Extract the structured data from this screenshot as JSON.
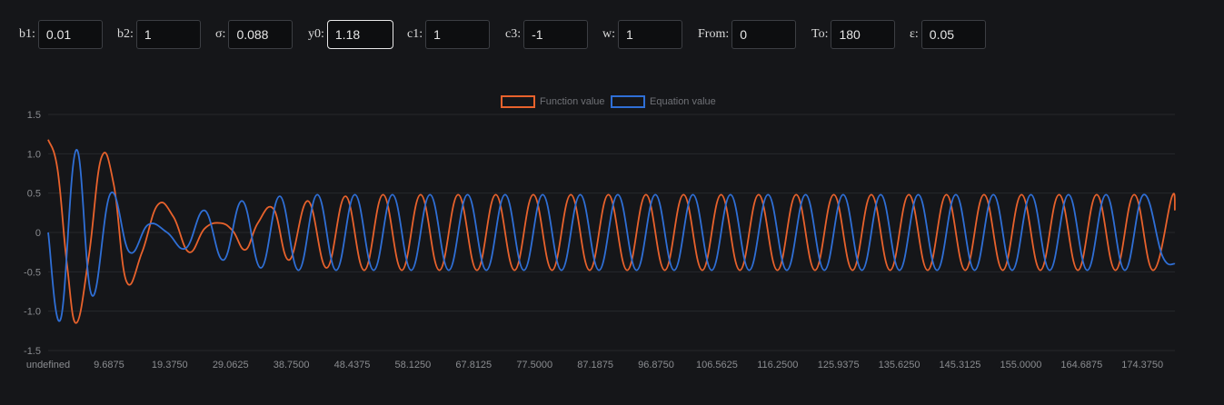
{
  "params": [
    {
      "id": "b1",
      "label": "b1:",
      "value": "0.01"
    },
    {
      "id": "b2",
      "label": "b2:",
      "value": "1"
    },
    {
      "id": "sigma",
      "label": "σ:",
      "value": "0.088"
    },
    {
      "id": "y0",
      "label": "y0:",
      "value": "1.18"
    },
    {
      "id": "c1",
      "label": "c1:",
      "value": "1"
    },
    {
      "id": "c3",
      "label": "c3:",
      "value": "-1"
    },
    {
      "id": "w",
      "label": "w:",
      "value": "1"
    },
    {
      "id": "from",
      "label": "From:",
      "value": "0"
    },
    {
      "id": "to",
      "label": "To:",
      "value": "180"
    },
    {
      "id": "eps",
      "label": "ε:",
      "value": "0.05"
    }
  ],
  "chart_data": {
    "type": "line",
    "title": "",
    "xlabel": "",
    "ylabel": "",
    "legend_position": "top-center",
    "grid": "horizontal",
    "ylim": [
      -1.5,
      1.5
    ],
    "y_ticks": [
      "1.5",
      "1.0",
      "0.5",
      "0",
      "-0.5",
      "-1.0",
      "-1.5"
    ],
    "x_tick_labels": [
      "undefined",
      "9.6875",
      "19.3750",
      "29.0625",
      "38.7500",
      "48.4375",
      "58.1250",
      "67.8125",
      "77.5000",
      "87.1875",
      "96.8750",
      "106.5625",
      "116.2500",
      "125.9375",
      "135.6250",
      "145.3125",
      "155.0000",
      "164.6875",
      "174.3750"
    ],
    "xlim": [
      0,
      180
    ],
    "series": [
      {
        "name": "Function value",
        "color": "#e8622c",
        "points": [
          [
            0,
            1.18
          ],
          [
            1.5,
            0.8
          ],
          [
            3,
            -0.4
          ],
          [
            4.5,
            -1.15
          ],
          [
            6.5,
            -0.3
          ],
          [
            8.5,
            0.95
          ],
          [
            10.5,
            0.6
          ],
          [
            12.5,
            -0.62
          ],
          [
            15,
            -0.25
          ],
          [
            17.5,
            0.35
          ],
          [
            20,
            0.2
          ],
          [
            22.5,
            -0.25
          ],
          [
            25,
            0.05
          ],
          [
            27.5,
            0.12
          ],
          [
            29.5,
            0.02
          ],
          [
            31.5,
            -0.22
          ],
          [
            33.5,
            0.12
          ],
          [
            36,
            0.3
          ],
          [
            38.5,
            -0.35
          ],
          [
            41.5,
            0.4
          ],
          [
            44.5,
            -0.45
          ],
          [
            47.5,
            0.46
          ],
          [
            50.5,
            -0.48
          ],
          [
            53.5,
            0.48
          ],
          [
            56.5,
            -0.48
          ],
          [
            59.5,
            0.48
          ],
          [
            62.5,
            -0.48
          ],
          [
            65.5,
            0.48
          ],
          [
            68.5,
            -0.48
          ],
          [
            71.5,
            0.48
          ],
          [
            74.5,
            -0.48
          ],
          [
            77.5,
            0.48
          ],
          [
            80.5,
            -0.48
          ],
          [
            83.5,
            0.48
          ],
          [
            86.5,
            -0.48
          ],
          [
            89.5,
            0.48
          ],
          [
            92.5,
            -0.48
          ],
          [
            95.5,
            0.48
          ],
          [
            98.5,
            -0.48
          ],
          [
            101.5,
            0.48
          ],
          [
            104.5,
            -0.48
          ],
          [
            107.5,
            0.48
          ],
          [
            110.5,
            -0.48
          ],
          [
            113.5,
            0.48
          ],
          [
            116.5,
            -0.48
          ],
          [
            119.5,
            0.48
          ],
          [
            122.5,
            -0.48
          ],
          [
            125.5,
            0.48
          ],
          [
            128.5,
            -0.48
          ],
          [
            131.5,
            0.48
          ],
          [
            134.5,
            -0.48
          ],
          [
            137.5,
            0.48
          ],
          [
            140.5,
            -0.48
          ],
          [
            143.5,
            0.48
          ],
          [
            146.5,
            -0.48
          ],
          [
            149.5,
            0.48
          ],
          [
            152.5,
            -0.48
          ],
          [
            155.5,
            0.48
          ],
          [
            158.5,
            -0.48
          ],
          [
            161.5,
            0.48
          ],
          [
            164.5,
            -0.48
          ],
          [
            167.5,
            0.48
          ],
          [
            170.5,
            -0.48
          ],
          [
            173.5,
            0.48
          ],
          [
            176.5,
            -0.48
          ],
          [
            179.5,
            0.45
          ],
          [
            180,
            0.28
          ]
        ]
      },
      {
        "name": "Equation value",
        "color": "#2f6fd6",
        "points": [
          [
            0,
            0
          ],
          [
            2,
            -1.1
          ],
          [
            4.5,
            1.05
          ],
          [
            7,
            -0.8
          ],
          [
            10,
            0.5
          ],
          [
            13,
            -0.25
          ],
          [
            16,
            0.1
          ],
          [
            19,
            0.0
          ],
          [
            22,
            -0.2
          ],
          [
            25,
            0.28
          ],
          [
            28,
            -0.35
          ],
          [
            31,
            0.4
          ],
          [
            34,
            -0.45
          ],
          [
            37,
            0.46
          ],
          [
            40,
            -0.48
          ],
          [
            43,
            0.48
          ],
          [
            46,
            -0.48
          ],
          [
            49,
            0.48
          ],
          [
            52,
            -0.48
          ],
          [
            55,
            0.48
          ],
          [
            58,
            -0.48
          ],
          [
            61,
            0.48
          ],
          [
            64,
            -0.48
          ],
          [
            67,
            0.48
          ],
          [
            70,
            -0.48
          ],
          [
            73,
            0.48
          ],
          [
            76,
            -0.48
          ],
          [
            79,
            0.48
          ],
          [
            82,
            -0.48
          ],
          [
            85,
            0.48
          ],
          [
            88,
            -0.48
          ],
          [
            91,
            0.48
          ],
          [
            94,
            -0.48
          ],
          [
            97,
            0.48
          ],
          [
            100,
            -0.48
          ],
          [
            103,
            0.48
          ],
          [
            106,
            -0.48
          ],
          [
            109,
            0.48
          ],
          [
            112,
            -0.48
          ],
          [
            115,
            0.48
          ],
          [
            118,
            -0.48
          ],
          [
            121,
            0.48
          ],
          [
            124,
            -0.48
          ],
          [
            127,
            0.48
          ],
          [
            130,
            -0.48
          ],
          [
            133,
            0.48
          ],
          [
            136,
            -0.48
          ],
          [
            139,
            0.48
          ],
          [
            142,
            -0.48
          ],
          [
            145,
            0.48
          ],
          [
            148,
            -0.48
          ],
          [
            151,
            0.48
          ],
          [
            154,
            -0.48
          ],
          [
            157,
            0.48
          ],
          [
            160,
            -0.48
          ],
          [
            163,
            0.48
          ],
          [
            166,
            -0.48
          ],
          [
            169,
            0.48
          ],
          [
            172,
            -0.48
          ],
          [
            175,
            0.48
          ],
          [
            178,
            -0.3
          ],
          [
            180,
            -0.4
          ]
        ]
      }
    ]
  }
}
